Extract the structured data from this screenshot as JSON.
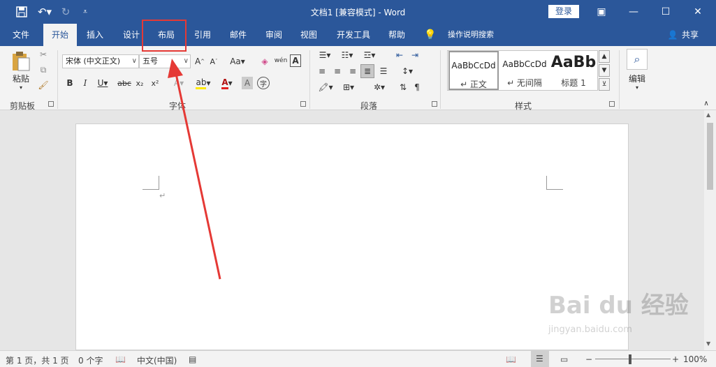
{
  "window": {
    "title": "文档1 [兼容模式] - Word",
    "login_label": "登录"
  },
  "quick_access": {
    "save_icon": "save-icon",
    "undo_icon": "undo-icon",
    "redo_icon": "redo-icon",
    "customize_icon": "customize-icon"
  },
  "tabs": [
    {
      "label": "文件"
    },
    {
      "label": "开始"
    },
    {
      "label": "插入"
    },
    {
      "label": "设计"
    },
    {
      "label": "布局"
    },
    {
      "label": "引用"
    },
    {
      "label": "邮件"
    },
    {
      "label": "审阅"
    },
    {
      "label": "视图"
    },
    {
      "label": "开发工具"
    },
    {
      "label": "帮助"
    }
  ],
  "tell_me": "操作说明搜索",
  "share_label": "共享",
  "ribbon": {
    "clipboard": {
      "paste_label": "粘贴",
      "group_label": "剪贴板"
    },
    "font": {
      "font_name": "宋体 (中文正文)",
      "font_size": "五号",
      "group_label": "字体"
    },
    "paragraph": {
      "group_label": "段落"
    },
    "styles": {
      "group_label": "样式",
      "items": [
        {
          "sample": "AaBbCcDd",
          "name": "↵ 正文"
        },
        {
          "sample": "AaBbCcDd",
          "name": "↵ 无间隔"
        },
        {
          "sample": "AaBb",
          "name": "标题 1"
        }
      ]
    },
    "editing": {
      "label": "编辑"
    }
  },
  "document": {
    "paragraph_mark": "↵"
  },
  "statusbar": {
    "page": "第 1 页，共 1 页",
    "words": "0 个字",
    "language": "中文(中国)",
    "zoom": "100%"
  },
  "watermark": {
    "text": "Bai du 经验",
    "url": "jingyan.baidu.com"
  },
  "colors": {
    "accent": "#2b579a",
    "annotation": "#e53935"
  }
}
